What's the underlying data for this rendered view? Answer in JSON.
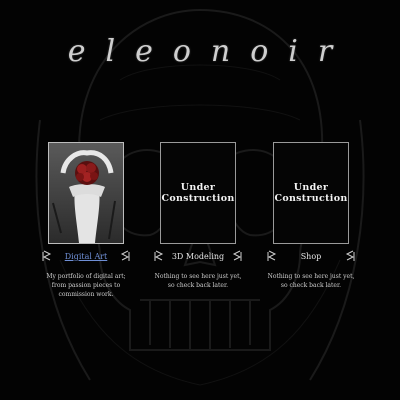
{
  "site": {
    "title": "eleonoir"
  },
  "cards": [
    {
      "label": "Digital Art",
      "is_link": true,
      "description": "My portfolio of digital art; from passion pieces to commission work.",
      "image": "digital-art-figure-with-red-roses"
    },
    {
      "label": "3D Modeling",
      "is_link": false,
      "placeholder": "Under Construction",
      "description": "Nothing to see here just yet, so check back later."
    },
    {
      "label": "Shop",
      "is_link": false,
      "placeholder": "Under Construction",
      "description": "Nothing to see here just yet, so check back later."
    }
  ],
  "colors": {
    "background": "#030303",
    "link": "#6f8fd6",
    "text": "#d8d8d8",
    "rose": "#8a1a1a"
  },
  "icons": {
    "label_ornament": "ornament-icon",
    "background": "skull-background"
  }
}
